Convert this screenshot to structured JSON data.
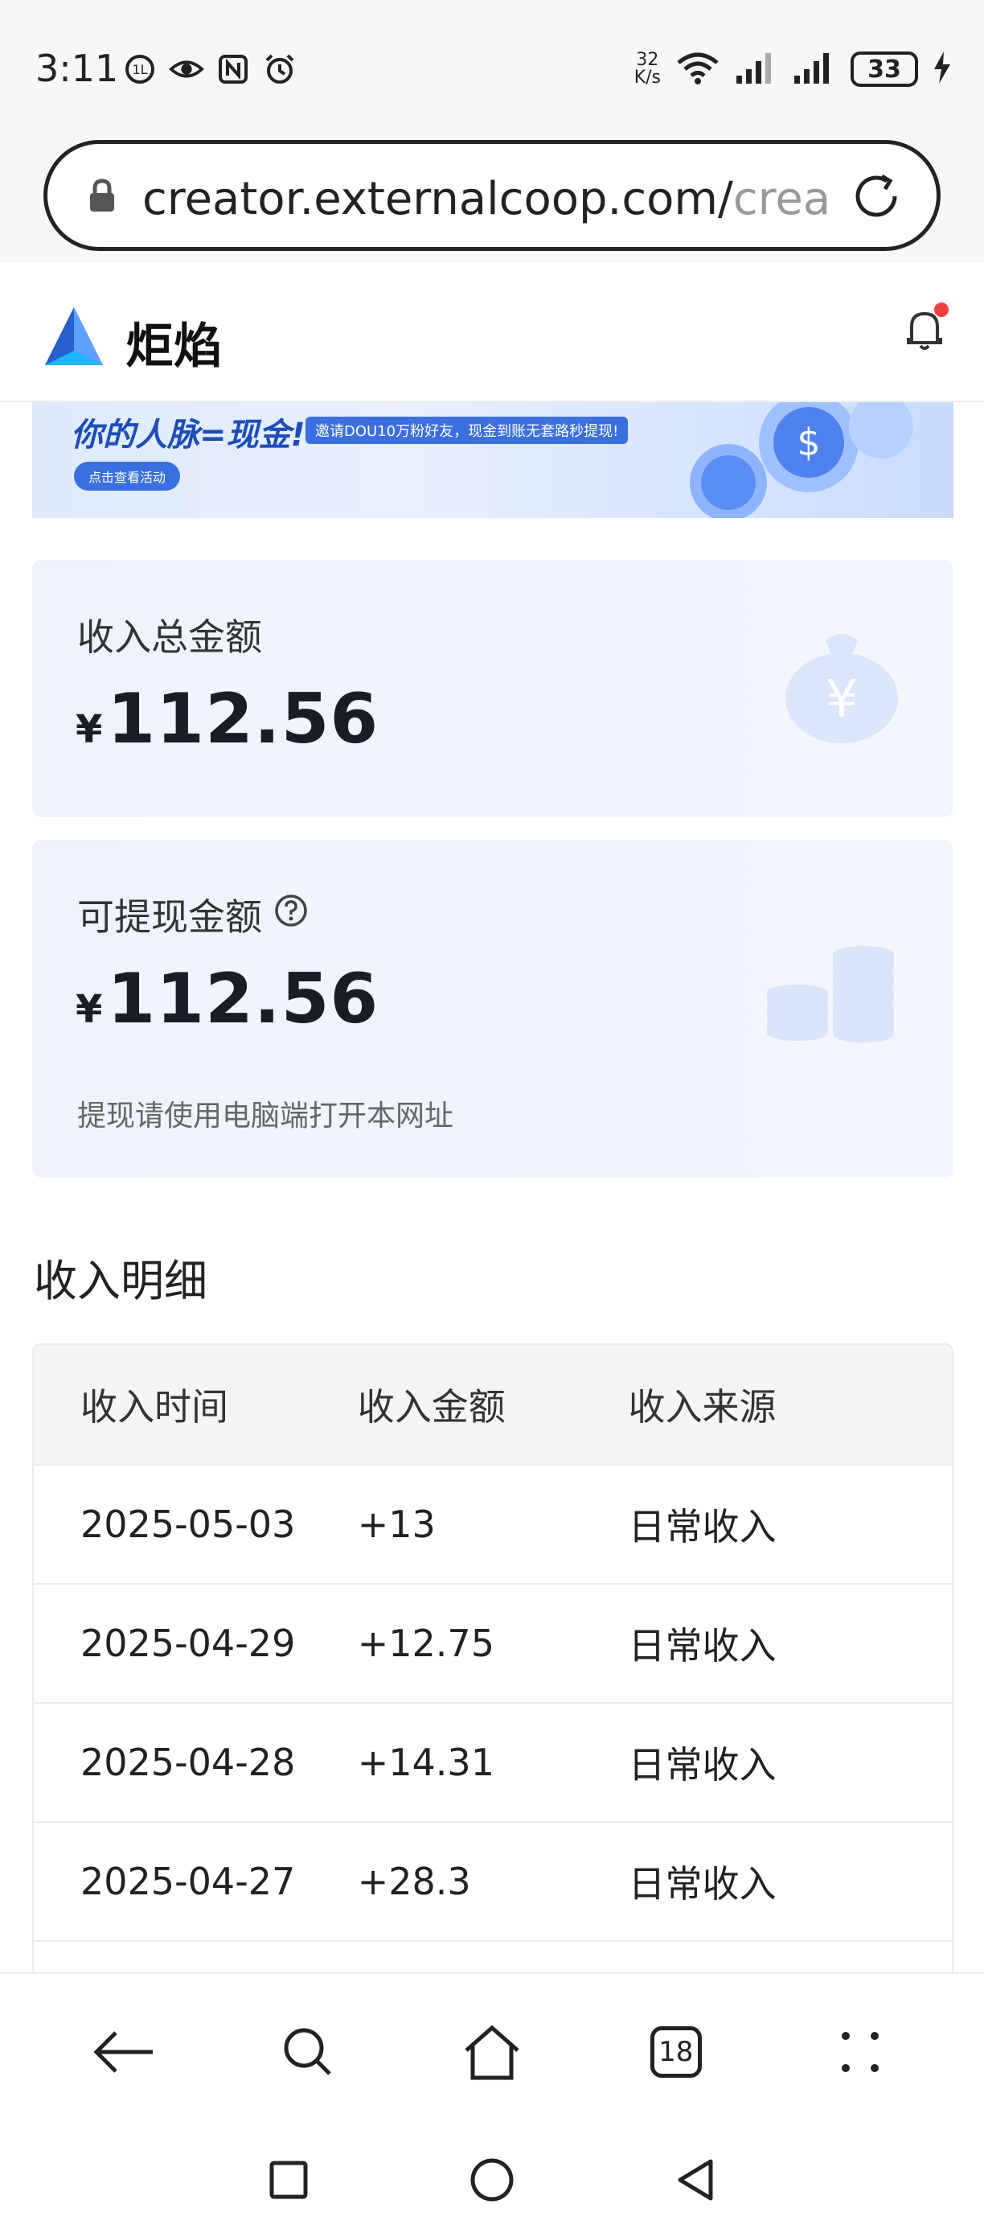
{
  "status_bar": {
    "time": "3:11",
    "net_speed_value": "32",
    "net_speed_unit": "K/s",
    "battery": "33"
  },
  "url_bar": {
    "url_main": "creator.externalcoop.com/",
    "url_faded": "crea"
  },
  "header": {
    "app_name": "炬焰"
  },
  "banner": {
    "title": "你的人脉=现金!",
    "subtitle": "邀请DOU10万粉好友，现金到账无套路秒提现!",
    "button": "点击查看活动"
  },
  "total_card": {
    "label": "收入总金额",
    "currency": "¥",
    "amount": "112.56",
    "deco_glyph": "¥"
  },
  "withdraw_card": {
    "label": "可提现金额",
    "currency": "¥",
    "amount": "112.56",
    "hint": "提现请使用电脑端打开本网址"
  },
  "income_section": {
    "title": "收入明细",
    "columns": [
      "收入时间",
      "收入金额",
      "收入来源"
    ],
    "rows": [
      {
        "date": "2025-05-03",
        "amount": "+13",
        "source": "日常收入"
      },
      {
        "date": "2025-04-29",
        "amount": "+12.75",
        "source": "日常收入"
      },
      {
        "date": "2025-04-28",
        "amount": "+14.31",
        "source": "日常收入"
      },
      {
        "date": "2025-04-27",
        "amount": "+28.3",
        "source": "日常收入"
      }
    ]
  },
  "bottom_bar": {
    "tabs_count": "18"
  },
  "colors": {
    "accent": "#3a6fe0",
    "notification_dot": "#f04141",
    "card_bg": "#eef3fd"
  }
}
